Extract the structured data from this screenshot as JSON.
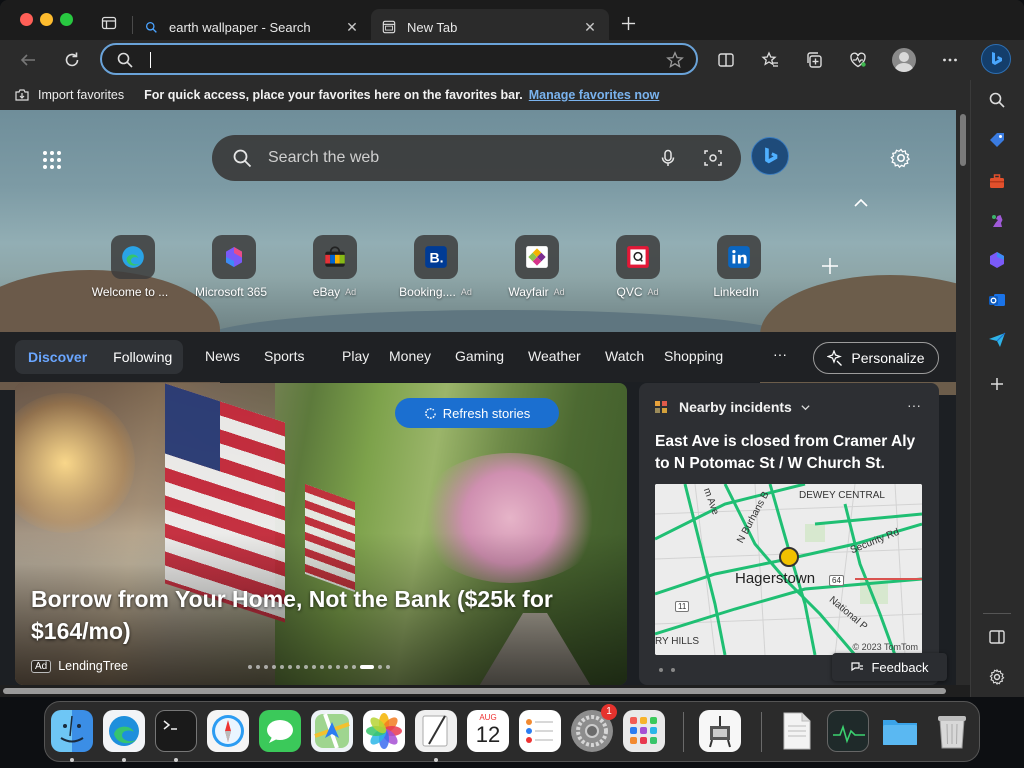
{
  "browser": {
    "tabs": [
      {
        "label": "earth wallpaper - Search",
        "icon": "search-icon"
      },
      {
        "label": "New Tab",
        "icon": "newtab-page-icon"
      }
    ],
    "address": {
      "value": "",
      "placeholder": ""
    }
  },
  "favorites_bar": {
    "import_label": "Import favorites",
    "message": "For quick access, place your favorites here on the favorites bar.",
    "link": "Manage favorites now"
  },
  "newtab": {
    "search_placeholder": "Search the web",
    "quick_links": [
      {
        "name": "Welcome to ...",
        "ad": "",
        "icon": "edge-icon"
      },
      {
        "name": "Microsoft 365",
        "ad": "",
        "icon": "m365-icon"
      },
      {
        "name": "eBay",
        "ad": "Ad",
        "icon": "ebay-icon"
      },
      {
        "name": "Booking....",
        "ad": "Ad",
        "icon": "booking-icon"
      },
      {
        "name": "Wayfair",
        "ad": "Ad",
        "icon": "wayfair-icon"
      },
      {
        "name": "QVC",
        "ad": "Ad",
        "icon": "qvc-icon"
      },
      {
        "name": "LinkedIn",
        "ad": "",
        "icon": "linkedin-icon"
      }
    ],
    "feed_tabs": {
      "discover": "Discover",
      "following": "Following"
    },
    "nav": [
      "News",
      "Sports",
      "Play",
      "Money",
      "Gaming",
      "Weather",
      "Watch",
      "Shopping"
    ],
    "more": "···",
    "personalize": "Personalize",
    "refresh": "Refresh stories",
    "story": {
      "headline": "Borrow from Your Home, Not the Bank ($25k for $164/mo)",
      "ad": "Ad",
      "source": "LendingTree"
    },
    "card": {
      "header": "Nearby incidents",
      "more": "···",
      "title": "East Ave is closed from Cramer Aly to N Potomac St / W Church St.",
      "map": {
        "city": "Hagerstown",
        "labels": [
          "DEWEY CENTRAL",
          "N Burhans B",
          "m Ave",
          "Security Rd",
          "National P",
          "RY HILLS"
        ],
        "route_badges": [
          "64",
          "11"
        ],
        "copyright": "© 2023 TomTom"
      }
    },
    "feedback": "Feedback",
    "peek": "S"
  },
  "colors": {
    "accent": "#1b6fd0",
    "discover": "#6aa6ff",
    "link": "#7ab3ee",
    "address_focus": "#6aa3d9"
  },
  "dock": {
    "calendar_month": "AUG",
    "calendar_day": "12",
    "settings_badge": "1"
  }
}
